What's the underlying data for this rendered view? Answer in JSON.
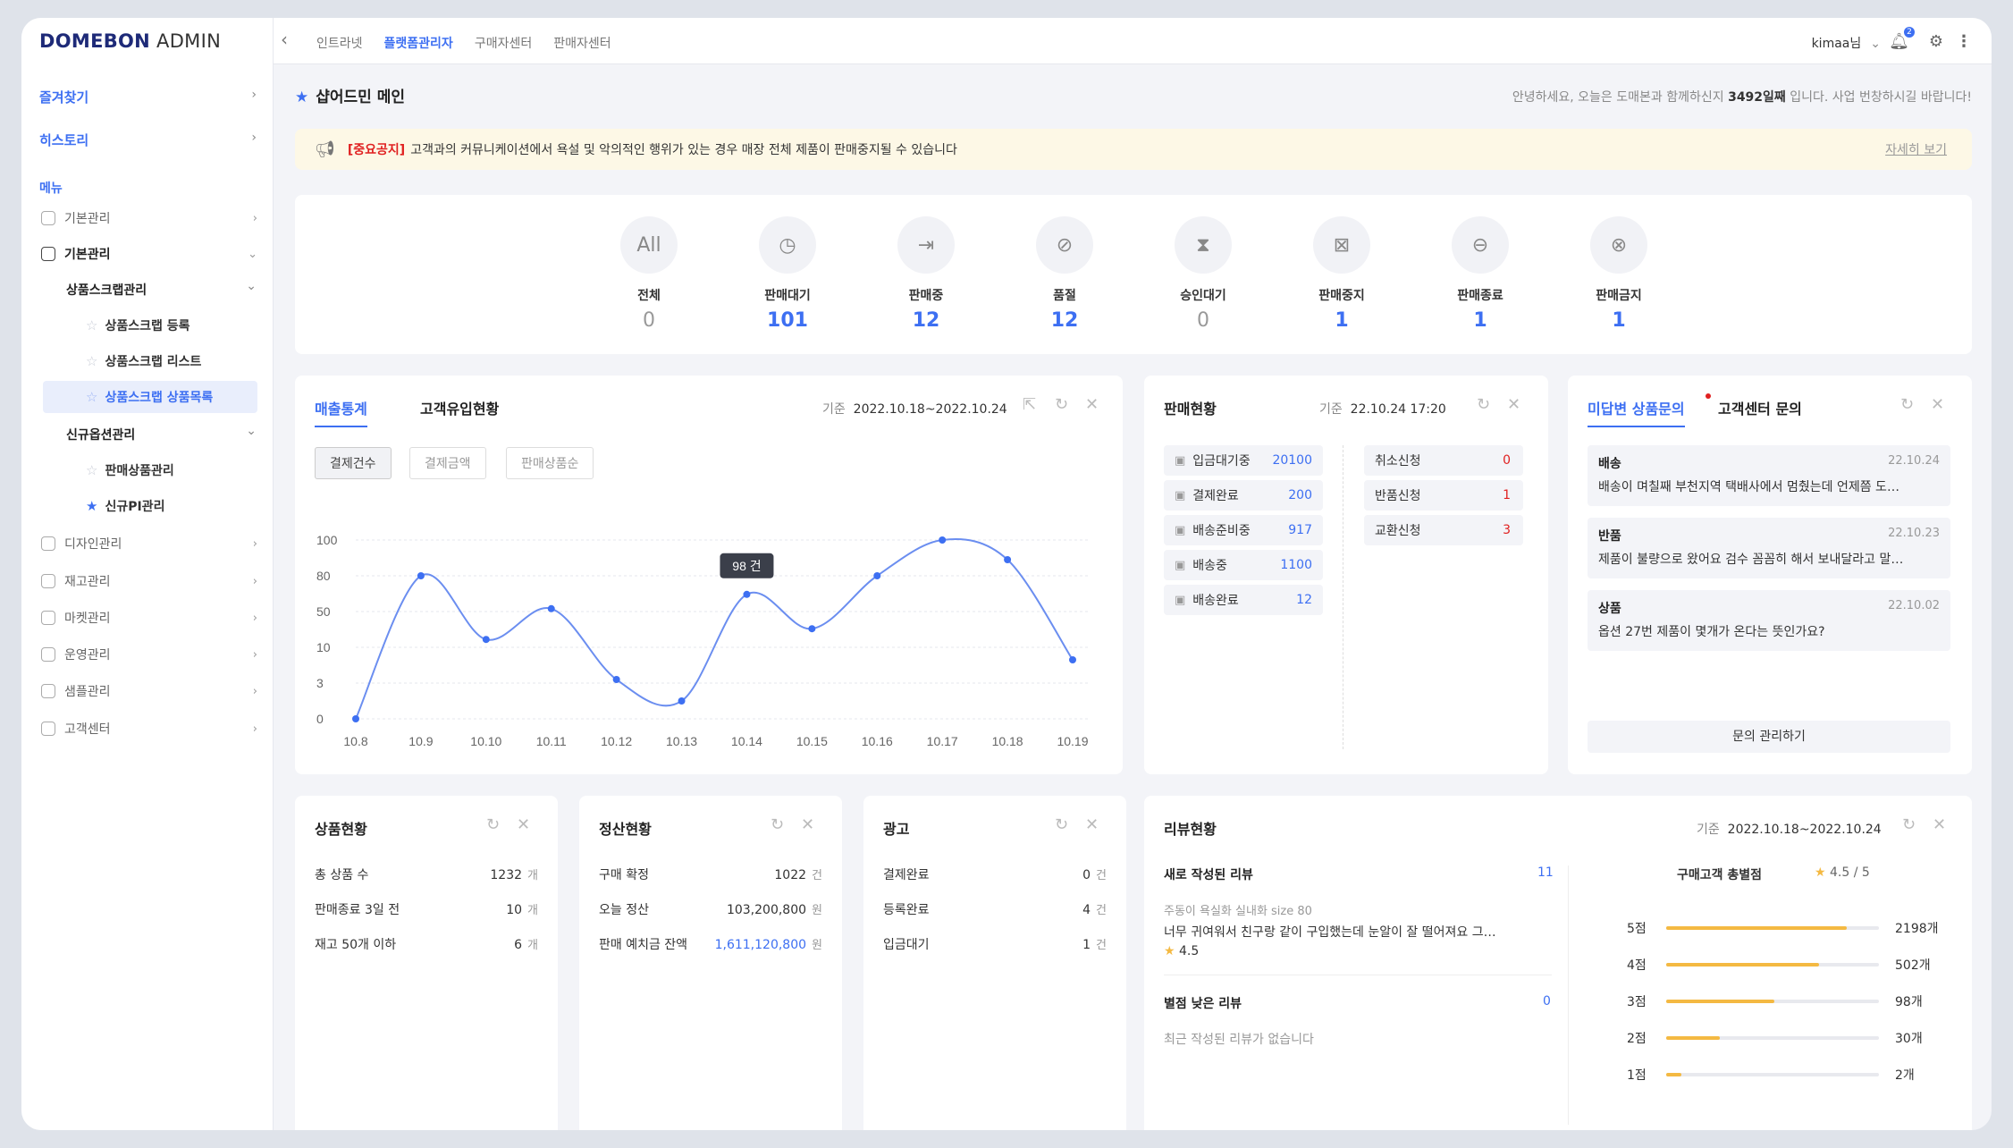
{
  "logo": {
    "bold": "DOMEBON",
    "thin": "ADMIN"
  },
  "sidebar": {
    "favorites": "즐겨찾기",
    "history": "히스토리",
    "menu_title": "메뉴",
    "items": [
      {
        "label": "기본관리"
      },
      {
        "label": "기본관리"
      },
      {
        "label": "디자인관리"
      },
      {
        "label": "재고관리"
      },
      {
        "label": "마켓관리"
      },
      {
        "label": "운영관리"
      },
      {
        "label": "샘플관리"
      },
      {
        "label": "고객센터"
      }
    ],
    "sub1": "상품스크랩관리",
    "sub1_items": [
      "상품스크랩 등록",
      "상품스크랩 리스트",
      "상품스크랩 상품목록"
    ],
    "sub2": "신규옵션관리",
    "sub2_items": [
      "판매상품관리",
      "신규PI관리"
    ]
  },
  "topnav": {
    "tabs": [
      "인트라넷",
      "플랫폼관리자",
      "구매자센터",
      "판매자센터"
    ],
    "user": "kimaa님",
    "notif_count": "2"
  },
  "page": {
    "title": "샵어드민 메인",
    "greeting_pre": "안녕하세요, 오늘은 도매본과 함께하신지 ",
    "greeting_days": "3492일째",
    "greeting_post": " 입니다. 사업 번창하시길 바랍니다!"
  },
  "notice": {
    "tag": "[중요공지]",
    "text": "고객과의 커뮤니케이션에서 욕설 및 악의적인 행위가 있는 경우 매장 전체 제품이 판매중지될 수 있습니다",
    "more": "자세히 보기"
  },
  "status": [
    {
      "label": "전체",
      "value": "0",
      "icon": "All"
    },
    {
      "label": "판매대기",
      "value": "101",
      "icon": "clock-box-icon"
    },
    {
      "label": "판매중",
      "value": "12",
      "icon": "arrow-box-icon"
    },
    {
      "label": "품절",
      "value": "12",
      "icon": "prohibit-icon"
    },
    {
      "label": "승인대기",
      "value": "0",
      "icon": "pending-box-icon"
    },
    {
      "label": "판매중지",
      "value": "1",
      "icon": "stop-box-icon"
    },
    {
      "label": "판매종료",
      "value": "1",
      "icon": "minus-circle-icon"
    },
    {
      "label": "판매금지",
      "value": "1",
      "icon": "x-circle-icon"
    }
  ],
  "sales": {
    "tab1": "매출통계",
    "tab2": "고객유입현황",
    "period_label": "기준",
    "period": "2022.10.18~2022.10.24",
    "pills": [
      "결제건수",
      "결제금액",
      "판매상품순"
    ],
    "tooltip": "98 건"
  },
  "chart_data": {
    "type": "line",
    "categories": [
      "10.8",
      "10.9",
      "10.10",
      "10.11",
      "10.12",
      "10.13",
      "10.14",
      "10.15",
      "10.16",
      "10.17",
      "10.18",
      "10.19"
    ],
    "y_ticks": [
      "100",
      "80",
      "50",
      "10",
      "3",
      "0"
    ],
    "values_tick_index": [
      0,
      4.0,
      2.22,
      3.08,
      1.1,
      0.5,
      3.48,
      2.52,
      4.0,
      5.0,
      4.45,
      1.65
    ]
  },
  "orders": {
    "title": "판매현황",
    "stamp_label": "기준",
    "stamp": "22.10.24 17:20",
    "left": [
      {
        "label": "입금대기중",
        "value": "20100"
      },
      {
        "label": "결제완료",
        "value": "200"
      },
      {
        "label": "배송준비중",
        "value": "917"
      },
      {
        "label": "배송중",
        "value": "1100"
      },
      {
        "label": "배송완료",
        "value": "12"
      }
    ],
    "right": [
      {
        "label": "취소신청",
        "value": "0"
      },
      {
        "label": "반품신청",
        "value": "1"
      },
      {
        "label": "교환신청",
        "value": "3"
      }
    ]
  },
  "inquiries": {
    "tab1": "미답변 상품문의",
    "tab2": "고객센터 문의",
    "items": [
      {
        "type": "배송",
        "date": "22.10.24",
        "text": "배송이 며칠째 부천지역 택배사에서 멈췄는데 언제쯤 도…"
      },
      {
        "type": "반품",
        "date": "22.10.23",
        "text": "제품이 불량으로 왔어요 검수 꼼꼼히 해서 보내달라고 말…"
      },
      {
        "type": "상품",
        "date": "22.10.02",
        "text": "옵션 27번 제품이 몇개가 온다는 뜻인가요?"
      }
    ],
    "button": "문의 관리하기"
  },
  "products": {
    "title": "상품현황",
    "rows": [
      {
        "label": "총 상품 수",
        "value": "1232",
        "unit": "개"
      },
      {
        "label": "판매종료 3일 전",
        "value": "10",
        "unit": "개"
      },
      {
        "label": "재고 50개 이하",
        "value": "6",
        "unit": "개"
      }
    ]
  },
  "settlement": {
    "title": "정산현황",
    "rows": [
      {
        "label": "구매 확정",
        "value": "1022",
        "unit": "건"
      },
      {
        "label": "오늘 정산",
        "value": "103,200,800",
        "unit": "원"
      },
      {
        "label": "판매 예치금 잔액",
        "value": "1,611,120,800",
        "unit": "원"
      }
    ]
  },
  "ads": {
    "title": "광고",
    "rows": [
      {
        "label": "결제완료",
        "value": "0",
        "unit": "건"
      },
      {
        "label": "등록완료",
        "value": "4",
        "unit": "건"
      },
      {
        "label": "입금대기",
        "value": "1",
        "unit": "건"
      }
    ]
  },
  "reviews": {
    "title": "리뷰현황",
    "period_label": "기준",
    "period": "2022.10.18~2022.10.24",
    "new_label": "새로 작성된 리뷰",
    "new_count": "11",
    "new_product": "주동이 욕실화 실내화 size 80",
    "new_text": "너무 귀여워서 친구랑 같이 구입했는데 눈알이 잘 떨어져요 그…",
    "new_rating": "4.5",
    "low_label": "별점 낮은 리뷰",
    "low_count": "0",
    "low_empty": "최근 작성된 리뷰가 없습니다",
    "total_label": "구매고객 총별점",
    "total": "4.5 / 5",
    "dist": [
      {
        "label": "5점",
        "count": "2198개",
        "ratio": 0.85
      },
      {
        "label": "4점",
        "count": "502개",
        "ratio": 0.72
      },
      {
        "label": "3점",
        "count": "98개",
        "ratio": 0.51
      },
      {
        "label": "2점",
        "count": "30개",
        "ratio": 0.25
      },
      {
        "label": "1점",
        "count": "2개",
        "ratio": 0.07
      }
    ]
  }
}
